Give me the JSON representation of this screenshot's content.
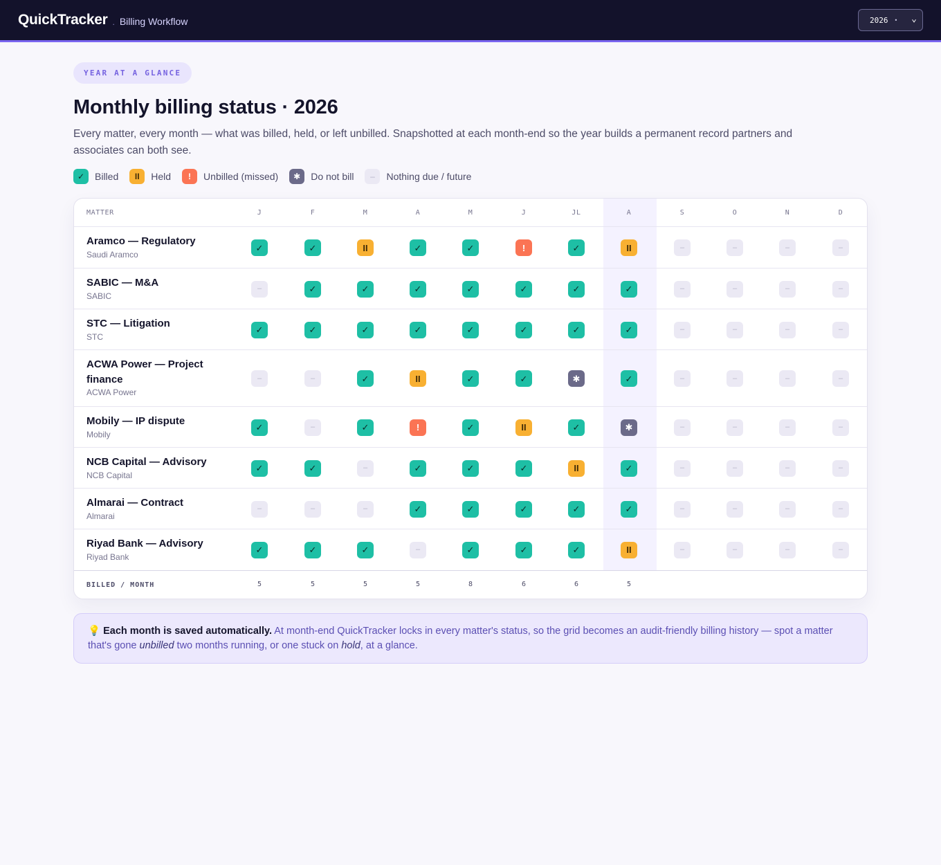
{
  "app": {
    "name": "QuickTracker",
    "separator": ".",
    "section": "Billing Workflow"
  },
  "year_select": {
    "value": "2026",
    "dot": "•",
    "chevron": "⌄"
  },
  "pill": "YEAR AT A GLANCE",
  "title": "Monthly billing status · 2026",
  "description": "Every matter, every month — what was billed, held, or left unbilled. Snapshotted at each month-end so the year builds a permanent record partners and associates can both see.",
  "legend": [
    {
      "status": "billed",
      "label": "Billed",
      "glyph": "✓"
    },
    {
      "status": "held",
      "label": "Held",
      "glyph": "II"
    },
    {
      "status": "unbilled",
      "label": "Unbilled (missed)",
      "glyph": "!"
    },
    {
      "status": "dnb",
      "label": "Do not bill",
      "glyph": "✱"
    },
    {
      "status": "none",
      "label": "Nothing due / future",
      "glyph": "–"
    }
  ],
  "glyphs": {
    "billed": "✓",
    "held": "II",
    "unbilled": "!",
    "dnb": "✱",
    "none": "–"
  },
  "table": {
    "matter_header": "MATTER",
    "months": [
      "J",
      "F",
      "M",
      "A",
      "M",
      "J",
      "JL",
      "A",
      "S",
      "O",
      "N",
      "D"
    ],
    "current_month_index": 7,
    "rows": [
      {
        "name": "Aramco — Regulatory",
        "client": "Saudi Aramco",
        "statuses": [
          "billed",
          "billed",
          "held",
          "billed",
          "billed",
          "unbilled",
          "billed",
          "held",
          "none",
          "none",
          "none",
          "none"
        ]
      },
      {
        "name": "SABIC — M&A",
        "client": "SABIC",
        "statuses": [
          "none",
          "billed",
          "billed",
          "billed",
          "billed",
          "billed",
          "billed",
          "billed",
          "none",
          "none",
          "none",
          "none"
        ]
      },
      {
        "name": "STC — Litigation",
        "client": "STC",
        "statuses": [
          "billed",
          "billed",
          "billed",
          "billed",
          "billed",
          "billed",
          "billed",
          "billed",
          "none",
          "none",
          "none",
          "none"
        ]
      },
      {
        "name": "ACWA Power — Project finance",
        "client": "ACWA Power",
        "statuses": [
          "none",
          "none",
          "billed",
          "held",
          "billed",
          "billed",
          "dnb",
          "billed",
          "none",
          "none",
          "none",
          "none"
        ]
      },
      {
        "name": "Mobily — IP dispute",
        "client": "Mobily",
        "statuses": [
          "billed",
          "none",
          "billed",
          "unbilled",
          "billed",
          "held",
          "billed",
          "dnb",
          "none",
          "none",
          "none",
          "none"
        ]
      },
      {
        "name": "NCB Capital — Advisory",
        "client": "NCB Capital",
        "statuses": [
          "billed",
          "billed",
          "none",
          "billed",
          "billed",
          "billed",
          "held",
          "billed",
          "none",
          "none",
          "none",
          "none"
        ]
      },
      {
        "name": "Almarai — Contract",
        "client": "Almarai",
        "statuses": [
          "none",
          "none",
          "none",
          "billed",
          "billed",
          "billed",
          "billed",
          "billed",
          "none",
          "none",
          "none",
          "none"
        ]
      },
      {
        "name": "Riyad Bank — Advisory",
        "client": "Riyad Bank",
        "statuses": [
          "billed",
          "billed",
          "billed",
          "none",
          "billed",
          "billed",
          "billed",
          "held",
          "none",
          "none",
          "none",
          "none"
        ]
      }
    ],
    "footer_label": "BILLED / MONTH",
    "billed_per_month": [
      "5",
      "5",
      "5",
      "5",
      "8",
      "6",
      "6",
      "5"
    ]
  },
  "note": {
    "icon": "💡",
    "bold": "Each month is saved automatically.",
    "text1": " At month-end QuickTracker locks in every matter's status, so the grid becomes an audit-friendly billing history — spot a matter that's gone ",
    "em1": "unbilled",
    "text2": " two months running, or one stuck on ",
    "em2": "hold",
    "text3": ", at a glance."
  }
}
